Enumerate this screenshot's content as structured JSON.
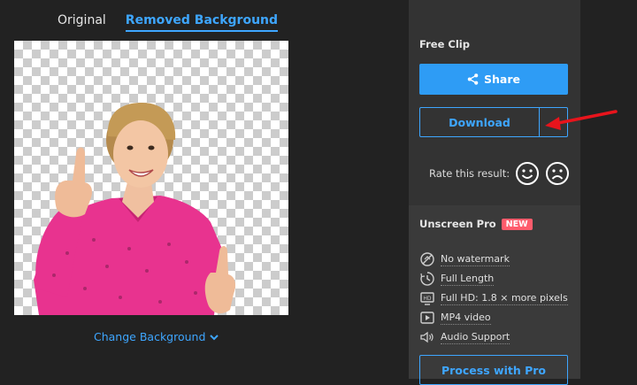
{
  "tabs": [
    {
      "label": "Original",
      "active": false
    },
    {
      "label": "Removed Background",
      "active": true
    }
  ],
  "preview": {
    "change_background_label": "Change Background"
  },
  "panel": {
    "free_clip_label": "Free Clip",
    "share_label": "Share",
    "download_label": "Download",
    "rate_label": "Rate this result:",
    "pro": {
      "title": "Unscreen Pro",
      "badge": "NEW",
      "features": [
        {
          "icon": "no-watermark-icon",
          "label": "No watermark"
        },
        {
          "icon": "full-length-icon",
          "label": "Full Length"
        },
        {
          "icon": "hd-icon",
          "label": "Full HD: 1.8 × more pixels"
        },
        {
          "icon": "video-file-icon",
          "label": "MP4 video"
        },
        {
          "icon": "speaker-icon",
          "label": "Audio Support"
        }
      ],
      "process_label": "Process with Pro"
    }
  },
  "colors": {
    "accent": "#3ea6ff",
    "share_bg": "#2e9cf5",
    "new_badge": "#ff5c6c",
    "arrow": "#e8141c",
    "shirt": "#e8338f"
  }
}
